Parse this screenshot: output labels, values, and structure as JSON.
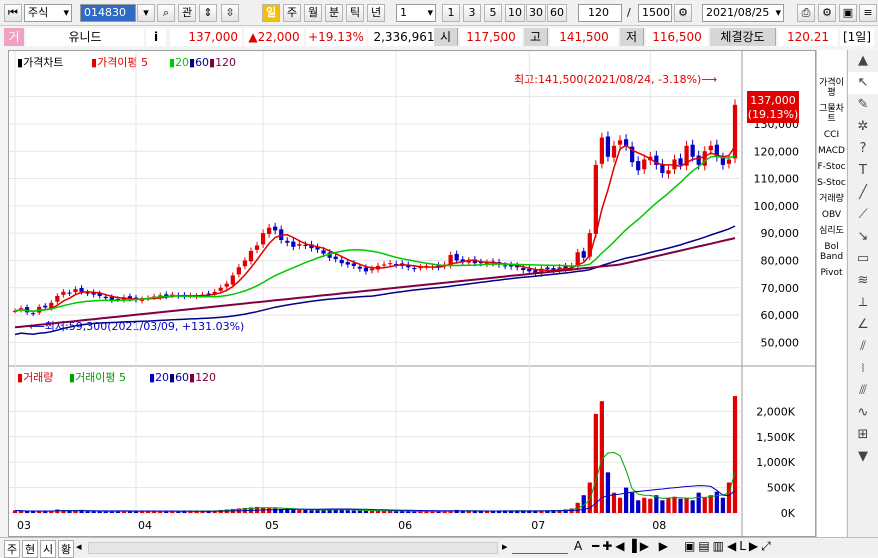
{
  "toolbar": {
    "market": "주식",
    "code": "014830",
    "btn_search": "⌕",
    "btn_kwan": "관",
    "periods": [
      "일",
      "주",
      "월",
      "분",
      "틱",
      "년"
    ],
    "interval_value": "1",
    "intervals": [
      "1",
      "3",
      "5",
      "10",
      "30",
      "60"
    ],
    "count": "120",
    "total": "1500",
    "date": "2021/08/25"
  },
  "info": {
    "flag": "거",
    "name": "유니드",
    "i": "i",
    "price": "137,000",
    "change": "▲22,000",
    "rate": "+19.13%",
    "volume": "2,336,961",
    "open_label": "시",
    "open": "117,500",
    "high_label": "고",
    "high": "141,500",
    "low_label": "저",
    "low": "116,500",
    "strength_label": "체결강도",
    "strength": "120.21",
    "period_tag": "[1일]"
  },
  "price_legend": {
    "price": "가격차트",
    "ma": "가격이평",
    "ma5": "5",
    "ma20": "20",
    "ma60": "60",
    "ma120": "120"
  },
  "vol_legend": {
    "vol": "거래량",
    "ma": "거래이평",
    "ma5": "5",
    "ma20": "20",
    "ma60": "60",
    "ma120": "120"
  },
  "annotations": {
    "high": "최고:141,500(2021/08/24, -3.18%)⟶",
    "low": "⟵최저:59,300(2021/03/09, +131.03%)",
    "cur_price": "137,000",
    "cur_rate": "(19.13%)"
  },
  "right_menu": [
    "가격이평",
    "그물차트",
    "CCI",
    "MACD",
    "F-Stoc",
    "S-Stoc",
    "거래량",
    "OBV",
    "심리도",
    "Bol Band",
    "Pivot"
  ],
  "bottom": {
    "tabs": [
      "주",
      "현",
      "시",
      "황"
    ]
  },
  "colors": {
    "up": "#e00000",
    "down": "#0000c8",
    "ma5": "#e00000",
    "ma20": "#00c800",
    "ma60": "#00008b",
    "ma120": "#800040"
  },
  "chart_data": {
    "type": "candlestick",
    "x_ticks": [
      "03",
      "04",
      "05",
      "06",
      "07",
      "08"
    ],
    "y_price_ticks": [
      "140,000",
      "130,000",
      "120,000",
      "110,000",
      "100,000",
      "90,000",
      "80,000",
      "70,000",
      "60,000",
      "50,000"
    ],
    "y_price_range": [
      45000,
      145000
    ],
    "y_vol_ticks": [
      "2,000K",
      "1,500K",
      "1,000K",
      "500K",
      "0K"
    ],
    "y_vol_range": [
      0,
      2400000
    ],
    "close": [
      61500,
      62500,
      61000,
      60500,
      63000,
      62800,
      64500,
      67000,
      68500,
      68000,
      69500,
      68500,
      68000,
      67500,
      67000,
      66200,
      65500,
      65800,
      66500,
      66000,
      65500,
      65800,
      66200,
      66800,
      67200,
      66800,
      67500,
      67000,
      66800,
      67200,
      67000,
      67500,
      67800,
      68500,
      70000,
      71500,
      74500,
      77500,
      80000,
      83500,
      85500,
      90000,
      92000,
      91000,
      87500,
      86500,
      85000,
      86000,
      85500,
      84500,
      84000,
      82500,
      81000,
      80500,
      79000,
      78500,
      78000,
      77000,
      76000,
      77000,
      78000,
      78500,
      79000,
      78500,
      78000,
      77500,
      77000,
      77500,
      78000,
      77800,
      77500,
      78500,
      82000,
      80000,
      79500,
      80000,
      79000,
      79000,
      79200,
      79000,
      78500,
      78000,
      77800,
      77500,
      76500,
      76000,
      75500,
      77000,
      76800,
      76500,
      77500,
      77000,
      78000,
      83000,
      81000,
      90000,
      115000,
      125000,
      118000,
      122000,
      124000,
      122000,
      116000,
      113000,
      117000,
      118000,
      115000,
      112000,
      113000,
      117000,
      115000,
      122000,
      118000,
      115000,
      120000,
      122000,
      118000,
      115000,
      117000,
      137000
    ],
    "volume": [
      50,
      40,
      30,
      35,
      45,
      40,
      30,
      70,
      60,
      40,
      50,
      45,
      35,
      30,
      30,
      40,
      40,
      30,
      35,
      40,
      30,
      30,
      40,
      40,
      30,
      30,
      35,
      40,
      50,
      40,
      35,
      30,
      40,
      50,
      60,
      70,
      80,
      90,
      100,
      110,
      120,
      100,
      95,
      90,
      80,
      90,
      70,
      60,
      60,
      55,
      55,
      60,
      70,
      75,
      60,
      55,
      50,
      45,
      40,
      45,
      50,
      45,
      40,
      35,
      40,
      35,
      30,
      30,
      40,
      35,
      30,
      30,
      50,
      60,
      45,
      40,
      35,
      35,
      40,
      45,
      40,
      50,
      45,
      40,
      45,
      40,
      40,
      45,
      50,
      55,
      60,
      70,
      90,
      200,
      350,
      600,
      1950,
      2200,
      800,
      400,
      300,
      500,
      400,
      250,
      300,
      280,
      350,
      250,
      300,
      320,
      280,
      300,
      250,
      400,
      300,
      350,
      420,
      300,
      600,
      2300
    ]
  }
}
